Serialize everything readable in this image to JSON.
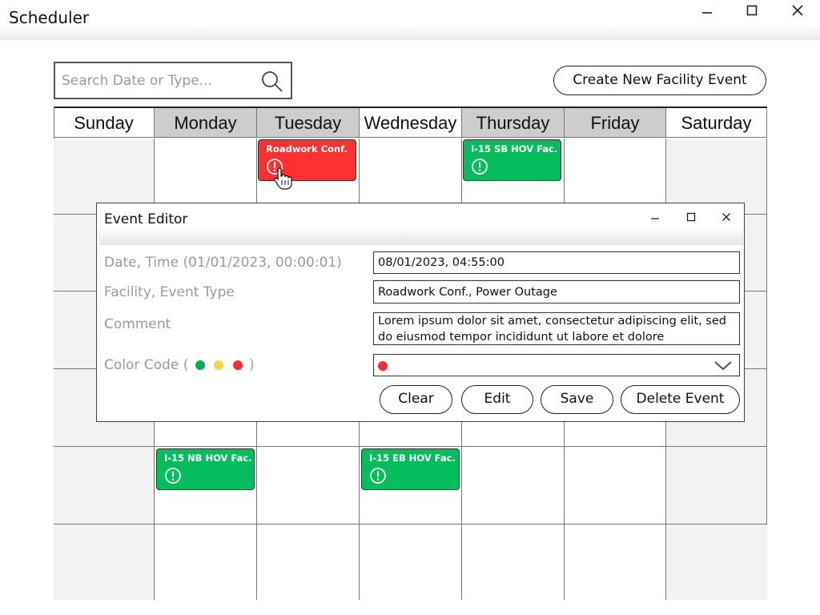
{
  "window": {
    "title": "Scheduler",
    "minimize": "—",
    "maximize": "☐",
    "close": "✕"
  },
  "search": {
    "placeholder": "Search Date or Type..."
  },
  "toolbar": {
    "create_label": "Create New Facility Event"
  },
  "calendar": {
    "days": [
      "Sunday",
      "Monday",
      "Tuesday",
      "Wednesday",
      "Thursday",
      "Friday",
      "Saturday"
    ],
    "events": [
      {
        "label": "Roadwork Conf.",
        "color": "#ff3030",
        "day": "Tuesday",
        "week": 1
      },
      {
        "label": "I-15 SB HOV Fac.",
        "color": "#05bd5c",
        "day": "Thursday",
        "week": 1
      },
      {
        "label": "I-15 NB HOV Fac.",
        "color": "#05bd5c",
        "day": "Monday",
        "week": 5
      },
      {
        "label": "I-15 EB HOV Fac.",
        "color": "#05bd5c",
        "day": "Wednesday",
        "week": 5
      }
    ]
  },
  "editor": {
    "title": "Event Editor",
    "minimize": "—",
    "maximize": "☐",
    "close": "✕",
    "date_label": "Date, Time (01/01/2023, 00:00:01)",
    "date_value": "08/01/2023, 04:55:00",
    "facility_label": "Facility, Event Type",
    "facility_value": "Roadwork Conf., Power Outage",
    "comment_label": "Comment",
    "comment_value": "Lorem ipsum dolor sit amet, consectetur adipiscing elit, sed do eiusmod tempor incididunt ut labore et dolore",
    "color_label_prefix": "Color Code (",
    "color_label_suffix": ")",
    "color_options": [
      "#00b050",
      "#ffd23f",
      "#ff2a2a"
    ],
    "selected_color": "#ff2a2a",
    "buttons": {
      "clear": "Clear",
      "edit": "Edit",
      "save": "Save",
      "delete": "Delete Event"
    }
  }
}
